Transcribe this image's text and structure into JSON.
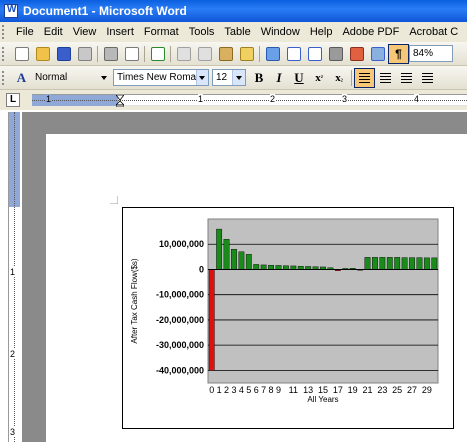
{
  "window": {
    "title": "Document1 - Microsoft Word"
  },
  "menu": [
    "File",
    "Edit",
    "View",
    "Insert",
    "Format",
    "Tools",
    "Table",
    "Window",
    "Help",
    "Adobe PDF",
    "Acrobat C"
  ],
  "toolbar": {
    "zoom": "84%",
    "style": "Normal",
    "font": "Times New Roman",
    "font_size": "12",
    "bold": "B",
    "italic": "I",
    "underline": "U"
  },
  "ruler": {
    "h_numbers": [
      "1",
      "1",
      "2",
      "3",
      "4"
    ],
    "v_numbers": [
      "1",
      "2",
      "3"
    ]
  },
  "colors": {
    "accent": "#0a5fe0",
    "positive_bar": "#1a8a1a",
    "negative_bar": "#e01010",
    "plot_bg": "#c0c0c0"
  },
  "paragraph_mark": "¶",
  "chart_data": {
    "type": "bar",
    "xlabel": "All Years",
    "ylabel": "After Tax Cash Flow($s)",
    "ylim": [
      -45000000,
      20000000
    ],
    "yticks": [
      -40000000,
      -30000000,
      -20000000,
      -10000000,
      0,
      10000000
    ],
    "ytick_labels": [
      "-40,000,000",
      "-30,000,000",
      "-20,000,000",
      "-10,000,000",
      "0",
      "10,000,000"
    ],
    "xtick_labels": [
      "0",
      "1",
      "2",
      "3",
      "4",
      "5",
      "6",
      "7",
      "8",
      "9",
      "11",
      "13",
      "15",
      "17",
      "19",
      "21",
      "23",
      "25",
      "27",
      "29"
    ],
    "grid": true,
    "categories": [
      0,
      1,
      2,
      3,
      4,
      5,
      6,
      7,
      8,
      9,
      10,
      11,
      12,
      13,
      14,
      15,
      16,
      17,
      18,
      19,
      20,
      21,
      22,
      23,
      24,
      25,
      26,
      27,
      28,
      29,
      30
    ],
    "values": [
      -40000000,
      16000000,
      12000000,
      8000000,
      7000000,
      6000000,
      2000000,
      1800000,
      1700000,
      1600000,
      1500000,
      1400000,
      1300000,
      1200000,
      1100000,
      1000000,
      700000,
      -500000,
      400000,
      500000,
      -300000,
      4800000,
      4800000,
      4800000,
      4800000,
      4800000,
      4700000,
      4700000,
      4700000,
      4600000,
      4600000
    ]
  }
}
